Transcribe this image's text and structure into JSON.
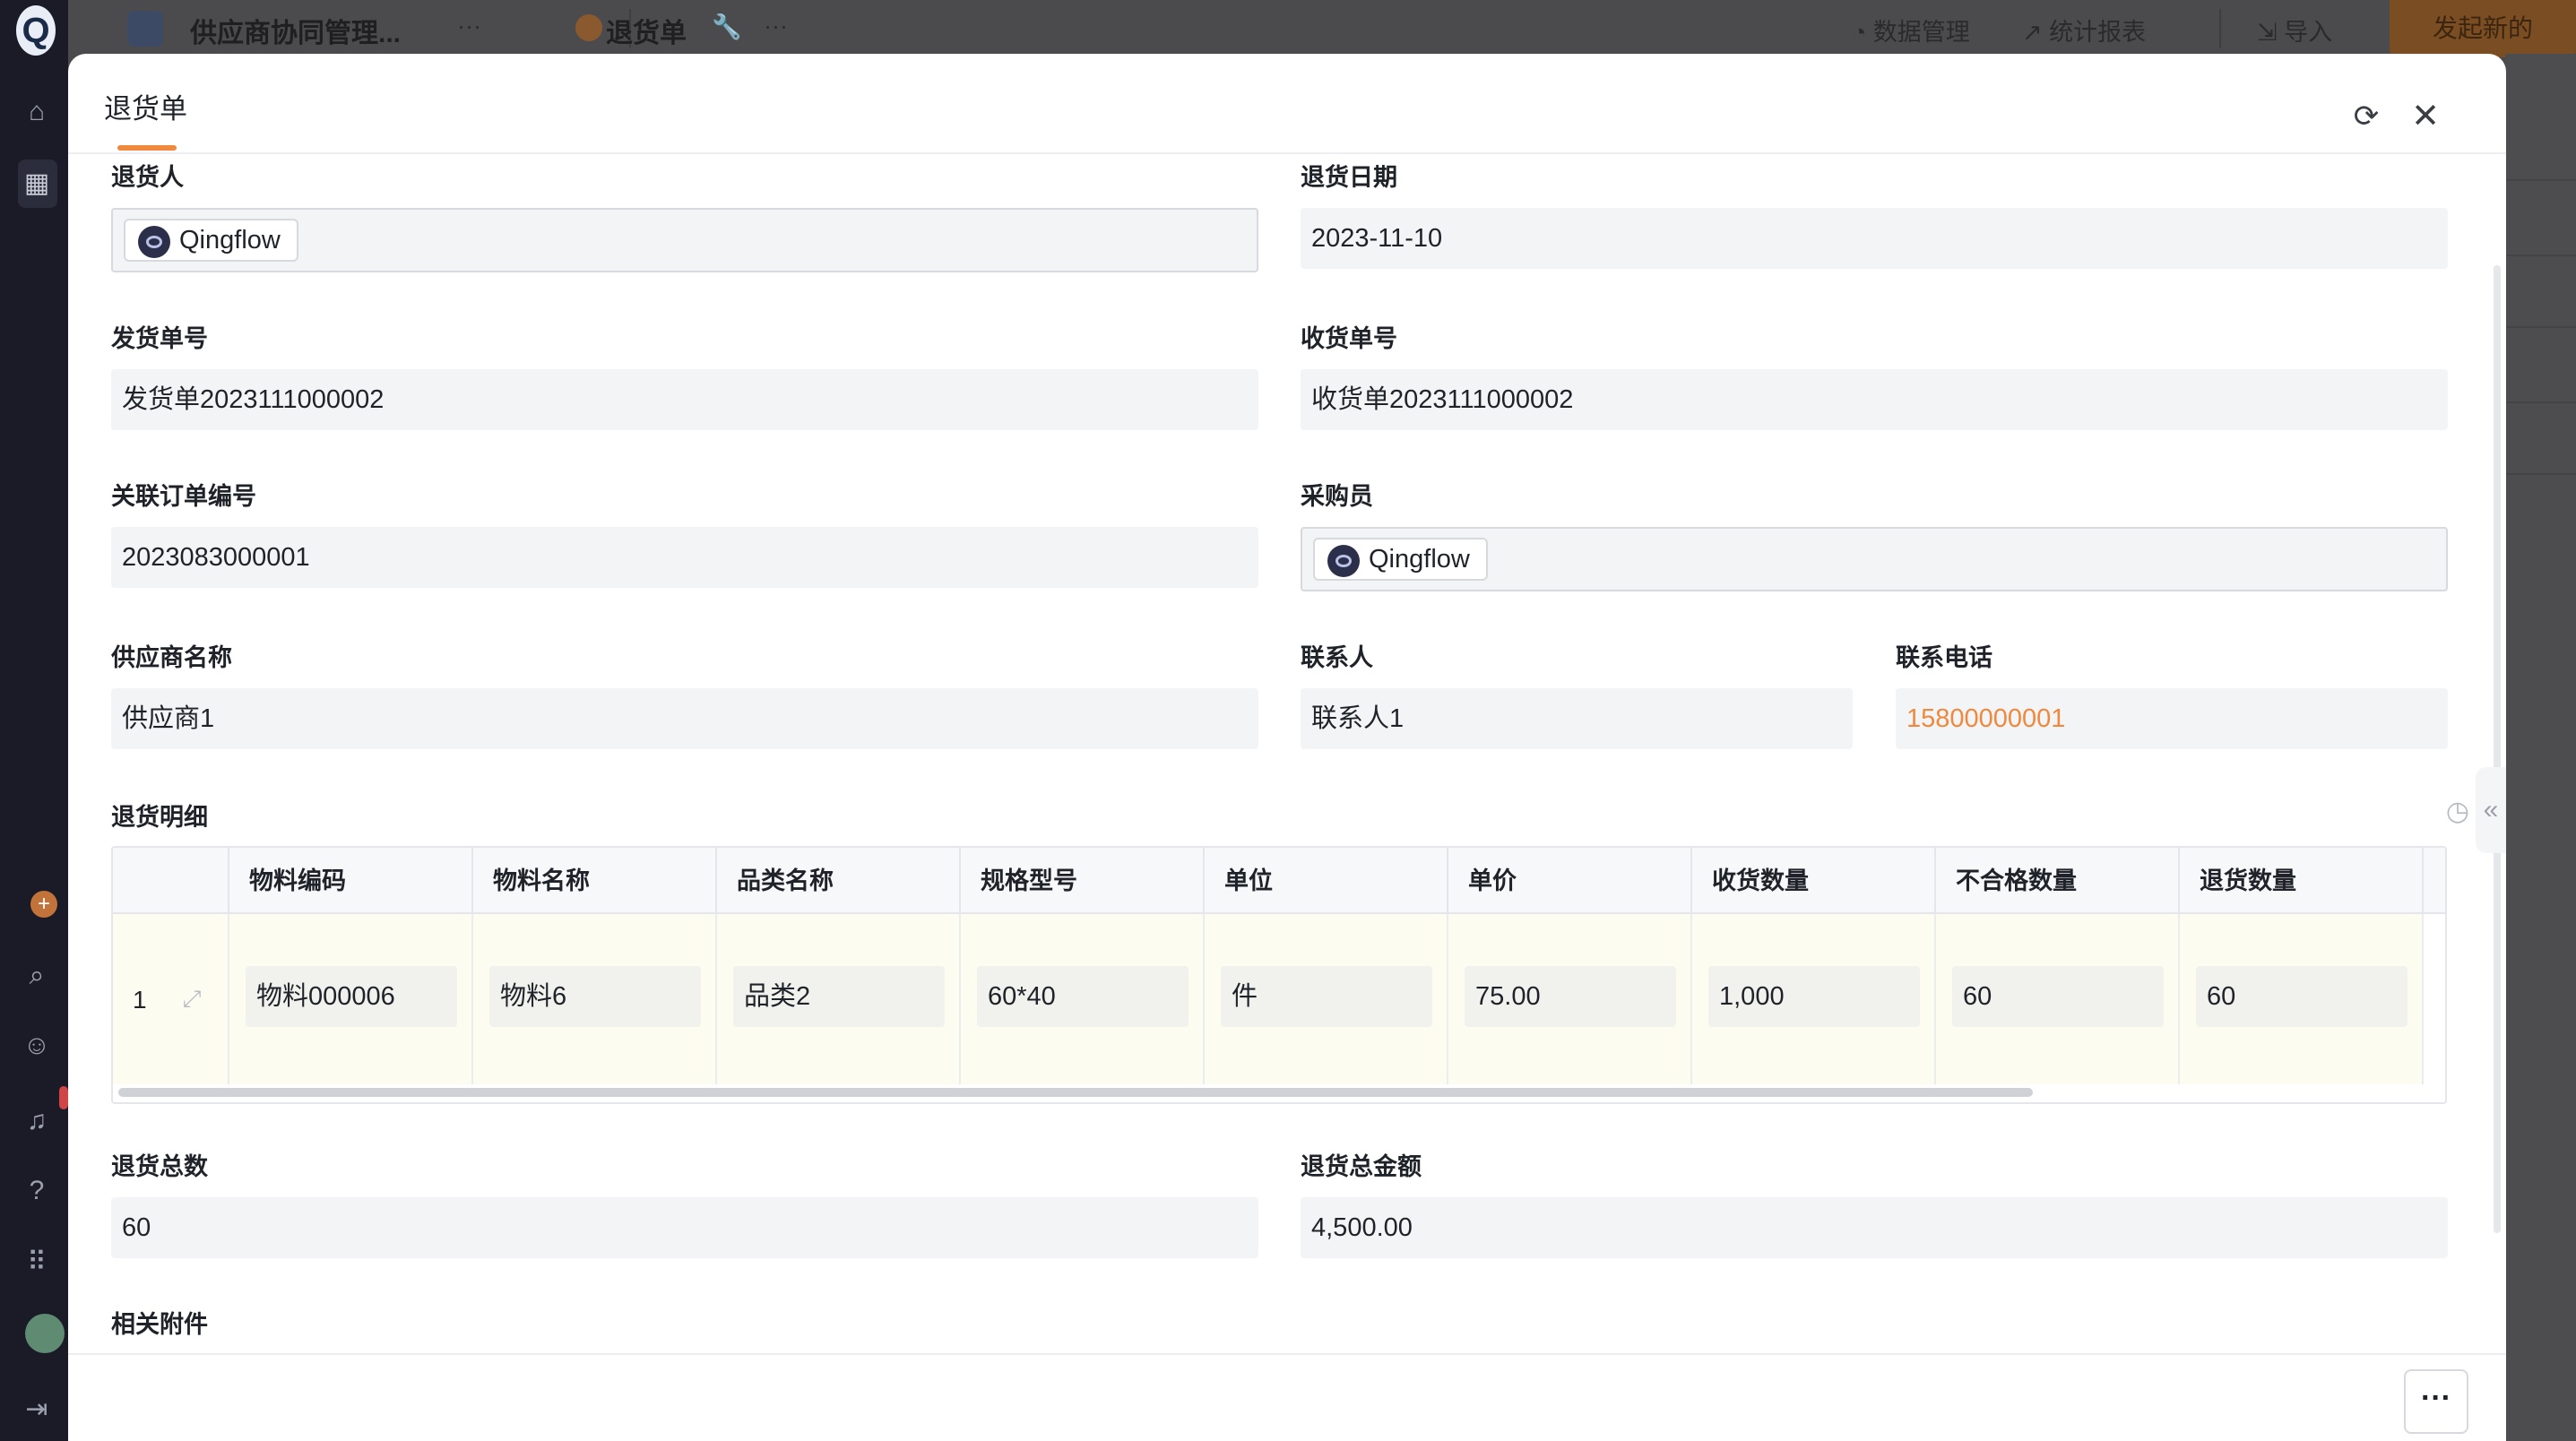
{
  "topbar": {
    "app_title": "供应商协同管理...",
    "more_glyph": "···",
    "form_title": "退货单",
    "data_manage": "数据管理",
    "stats_report": "统计报表",
    "import": "导入",
    "new_button": "发起新的"
  },
  "modal": {
    "title": "退货单",
    "fields": {
      "returner": {
        "label": "退货人",
        "value": "Qingflow"
      },
      "return_date": {
        "label": "退货日期",
        "value": "2023-11-10"
      },
      "shipment_no": {
        "label": "发货单号",
        "value": "发货单2023111000002"
      },
      "receipt_no": {
        "label": "收货单号",
        "value": "收货单2023111000002"
      },
      "order_no": {
        "label": "关联订单编号",
        "value": "2023083000001"
      },
      "buyer": {
        "label": "采购员",
        "value": "Qingflow"
      },
      "supplier": {
        "label": "供应商名称",
        "value": "供应商1"
      },
      "contact": {
        "label": "联系人",
        "value": "联系人1"
      },
      "phone": {
        "label": "联系电话",
        "value": "15800000001"
      },
      "detail": {
        "label": "退货明细"
      },
      "total_qty": {
        "label": "退货总数",
        "value": "60"
      },
      "total_amount": {
        "label": "退货总金额",
        "value": "4,500.00"
      },
      "attachments": {
        "label": "相关附件"
      }
    },
    "table": {
      "headers": [
        "物料编码",
        "物料名称",
        "品类名称",
        "规格型号",
        "单位",
        "单价",
        "收货数量",
        "不合格数量",
        "退货数量"
      ],
      "rows": [
        {
          "index": "1",
          "cells": [
            "物料000006",
            "物料6",
            "品类2",
            "60*40",
            "件",
            "75.00",
            "1,000",
            "60",
            "60"
          ]
        }
      ]
    },
    "footer": {
      "more_glyph": "···"
    }
  },
  "colors": {
    "accent": "#f0883e",
    "field_bg": "#f3f4f5"
  }
}
